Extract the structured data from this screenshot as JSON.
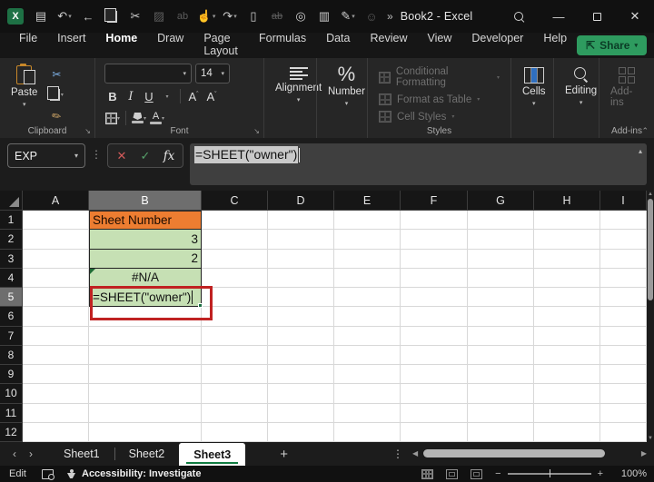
{
  "colors": {
    "accent_green": "#1EA15E",
    "tab_underline": "#107C41",
    "share_green": "#2E9B5F",
    "header_orange": "#ED7D31",
    "cell_green": "#C6E0B4",
    "annotation_red": "#C02222",
    "active_header_gray": "#6E6E6E",
    "excel_brand": "#1E7145"
  },
  "title_bar": {
    "title": "Book2 - Excel",
    "app_icon": "excel-logo",
    "qat": [
      {
        "name": "save-icon",
        "glyph": "▤"
      },
      {
        "name": "undo-icon",
        "glyph": "↶",
        "chevron": true
      },
      {
        "name": "back-icon",
        "glyph": "←"
      },
      {
        "name": "copy-icon",
        "glyph": ""
      },
      {
        "name": "cut-icon",
        "glyph": "✂"
      },
      {
        "name": "picture-icon",
        "glyph": "▨",
        "dim": true
      },
      {
        "name": "translate-icon",
        "glyph": "ab",
        "dim": true
      },
      {
        "name": "touch-mode-icon",
        "glyph": "☝",
        "chevron": true
      },
      {
        "name": "redo-icon",
        "glyph": "↷",
        "chevron": true
      },
      {
        "name": "new-file-icon",
        "glyph": "▯"
      },
      {
        "name": "clear-formats-icon",
        "glyph": "ab",
        "dim": true,
        "strike": true
      },
      {
        "name": "camera-icon",
        "glyph": "◎"
      },
      {
        "name": "find-sheet-icon",
        "glyph": "▥"
      },
      {
        "name": "draw-pen-icon",
        "glyph": "✎",
        "chevron": true
      },
      {
        "name": "permissions-icon",
        "glyph": "☺",
        "dim": true
      }
    ],
    "overflow_chevron": "»",
    "window_controls": {
      "minimize": "—",
      "maximize": "",
      "close": "✕"
    }
  },
  "ribbon_tabs": {
    "items": [
      "File",
      "Insert",
      "Home",
      "Draw",
      "Page Layout",
      "Formulas",
      "Data",
      "Review",
      "View",
      "Developer",
      "Help"
    ],
    "active": "Home",
    "share_label": "Share"
  },
  "ribbon": {
    "clipboard": {
      "label": "Clipboard",
      "paste_label": "Paste"
    },
    "font": {
      "label": "Font",
      "font_name_value": "",
      "font_size_value": "14",
      "bold": "B",
      "italic": "I",
      "underline": "U",
      "grow": "A",
      "shrink": "A"
    },
    "alignment": {
      "label": "Alignment"
    },
    "number": {
      "label": "Number",
      "percent": "%"
    },
    "styles": {
      "label": "Styles",
      "items": [
        "Conditional Formatting",
        "Format as Table",
        "Cell Styles"
      ]
    },
    "cells": {
      "label": "Cells",
      "button_label": "Cells"
    },
    "editing": {
      "label": "Editing",
      "button_label": "Editing"
    },
    "addins": {
      "label": "Add-ins",
      "button_label": "Add-ins"
    }
  },
  "formula_bar": {
    "name_box_value": "EXP",
    "cancel": "✕",
    "enter": "✓",
    "insert_function": "fx",
    "formula": "=SHEET(\"owner\")",
    "collapse": "▴"
  },
  "grid": {
    "columns": [
      "A",
      "B",
      "C",
      "D",
      "E",
      "F",
      "G",
      "H",
      "I"
    ],
    "active_column": "B",
    "rows": [
      1,
      2,
      3,
      4,
      5,
      6,
      7,
      8,
      9,
      10,
      11,
      12
    ],
    "active_row": 5,
    "cells": [
      {
        "ref": "B1",
        "row": 1,
        "col": "B",
        "text": "Sheet Number",
        "style": "orange",
        "align": "left"
      },
      {
        "ref": "B2",
        "row": 2,
        "col": "B",
        "text": "3",
        "style": "green",
        "align": "right"
      },
      {
        "ref": "B3",
        "row": 3,
        "col": "B",
        "text": "2",
        "style": "green",
        "align": "right"
      },
      {
        "ref": "B4",
        "row": 4,
        "col": "B",
        "text": "#N/A",
        "style": "green",
        "align": "center",
        "error_flag": true
      },
      {
        "ref": "B5",
        "row": 5,
        "col": "B",
        "text": "=SHEET(\"owner\")",
        "style": "green",
        "align": "left",
        "editing": true
      }
    ],
    "annotation": {
      "type": "rectangle",
      "target": "B5",
      "color": "#C02222"
    }
  },
  "sheet_tabs": {
    "nav_left": "‹",
    "nav_right": "›",
    "tabs": [
      {
        "label": "Sheet1",
        "active": false
      },
      {
        "label": "Sheet2",
        "active": false
      },
      {
        "label": "Sheet3",
        "active": true
      }
    ],
    "add_sheet": "+",
    "more": "⋮"
  },
  "status_bar": {
    "mode": "Edit",
    "accessibility_label": "Accessibility: Investigate",
    "zoom_minus": "−",
    "zoom_plus": "+",
    "zoom_level": "100%"
  }
}
